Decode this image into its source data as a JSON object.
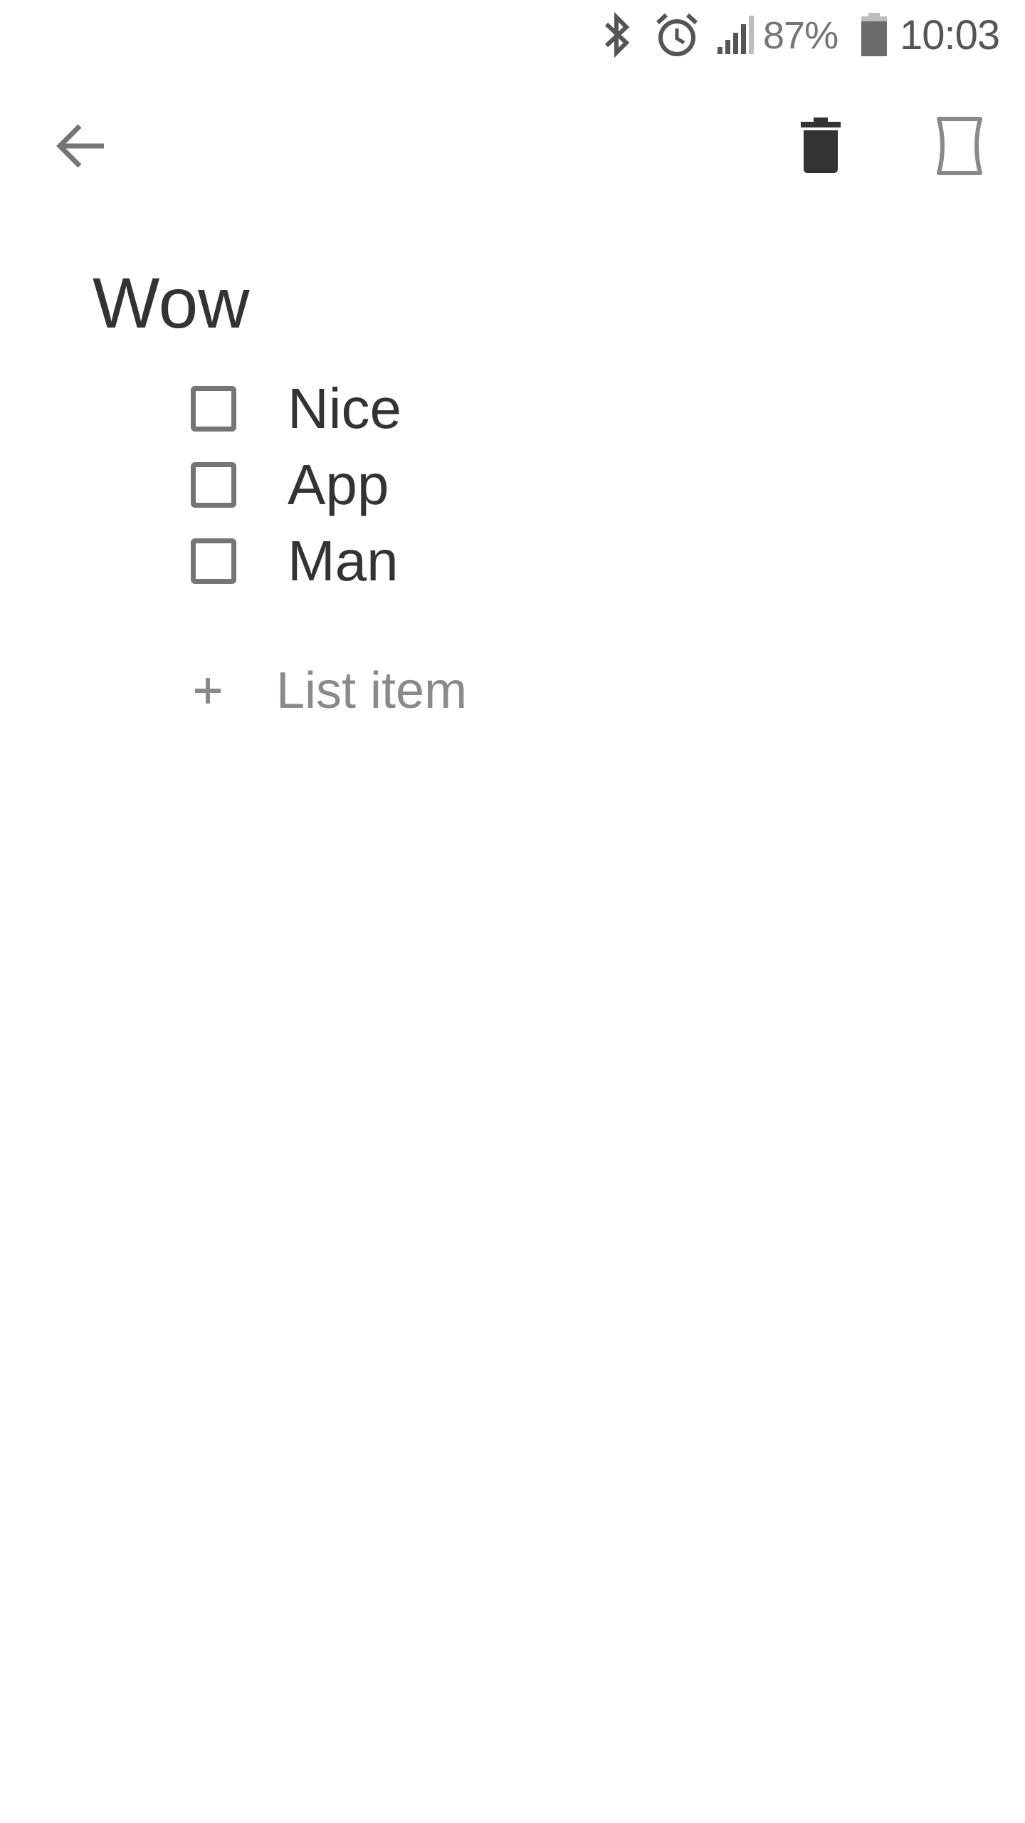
{
  "status_bar": {
    "icons": [
      "bluetooth-icon",
      "alarm-icon",
      "signal-icon",
      "battery-icon"
    ],
    "battery_percent": "87%",
    "time": "10:03"
  },
  "toolbar": {
    "back_icon": "arrow-back-icon",
    "delete_icon": "trash-icon",
    "restore_icon": "hourglass-frame-icon"
  },
  "note": {
    "title": "Wow",
    "items": [
      {
        "text": "Nice",
        "checked": false
      },
      {
        "text": "App",
        "checked": false
      },
      {
        "text": "Man",
        "checked": false
      }
    ],
    "add_item_label": "List item"
  },
  "colors": {
    "text": "#333333",
    "icon_gray": "#757575",
    "hint_gray": "#8a8a8a",
    "background": "#ffffff"
  }
}
